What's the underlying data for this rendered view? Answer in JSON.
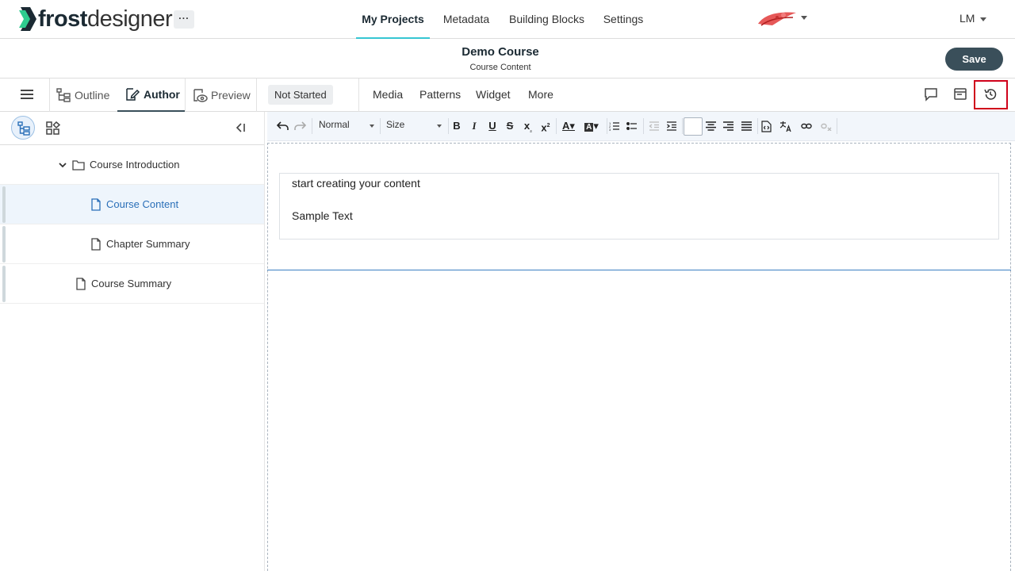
{
  "app": {
    "logo_bold": "frost",
    "logo_light": "designer",
    "more_label": "···",
    "brand_mark_icon": "brand-logo-icon",
    "user_initials": "LM"
  },
  "nav": {
    "tabs": [
      {
        "label": "My Projects",
        "active": true
      },
      {
        "label": "Metadata",
        "active": false
      },
      {
        "label": "Building Blocks",
        "active": false
      },
      {
        "label": "Settings",
        "active": false
      }
    ]
  },
  "course": {
    "title": "Demo Course",
    "subtitle": "Course Content",
    "save_label": "Save"
  },
  "modebar": {
    "tabs": [
      {
        "label": "Outline",
        "icon": "outline-icon"
      },
      {
        "label": "Author",
        "icon": "author-icon",
        "active": true
      },
      {
        "label": "Preview",
        "icon": "preview-icon"
      }
    ],
    "status": "Not Started",
    "insert_menus": [
      "Media",
      "Patterns",
      "Widget",
      "More"
    ],
    "right_icons": [
      "comment-icon",
      "panel-icon",
      "history-icon"
    ]
  },
  "tree": {
    "items": [
      {
        "label": "Course Introduction",
        "type": "folder",
        "level": 1,
        "expanded": true
      },
      {
        "label": "Course Content",
        "type": "page",
        "level": 2,
        "selected": true
      },
      {
        "label": "Chapter Summary",
        "type": "page",
        "level": 2
      },
      {
        "label": "Course Summary",
        "type": "page",
        "level": 1
      }
    ]
  },
  "editor": {
    "format_select": "Normal",
    "size_select": "Size",
    "lines": [
      "start creating your content",
      "Sample Text"
    ]
  },
  "colors": {
    "accent_teal": "#36c6d3",
    "save_bg": "#3a4f5a",
    "selection_blue": "#2a6fb8",
    "highlight_red": "#d0021b"
  }
}
